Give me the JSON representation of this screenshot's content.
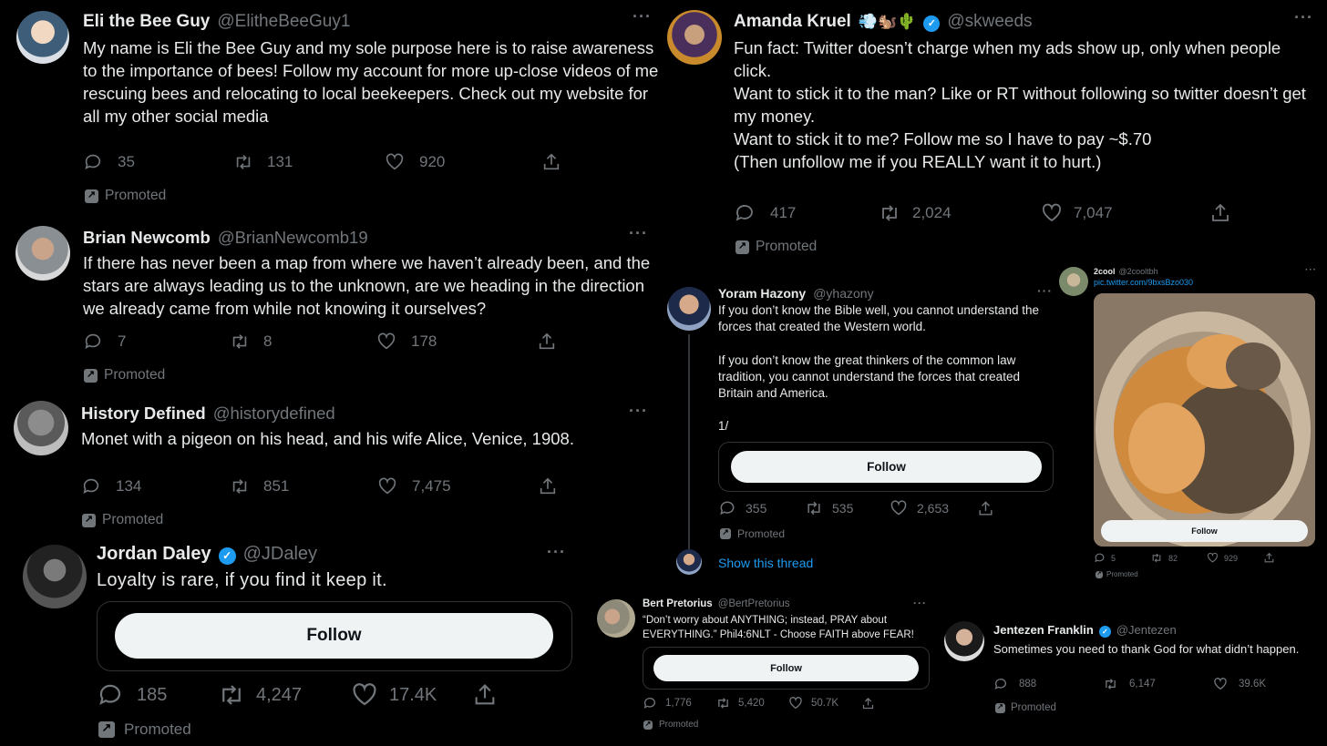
{
  "tweets": {
    "eli": {
      "name": "Eli the Bee Guy",
      "handle": "@ElitheBeeGuy1",
      "text": "My name is Eli the Bee Guy and my sole purpose here is to raise awareness to the importance of bees! Follow my account for more up-close videos of me rescuing bees and relocating to local beekeepers. Check out my website for all my other social media",
      "replies": "35",
      "retweets": "131",
      "likes": "920",
      "promoted": "Promoted"
    },
    "brian": {
      "name": "Brian Newcomb",
      "handle": "@BrianNewcomb19",
      "text": "If there has never been a map from where we haven’t already been, and the stars are always leading us to the unknown, are we heading in the direction we already came from while not knowing it ourselves?",
      "replies": "7",
      "retweets": "8",
      "likes": "178",
      "promoted": "Promoted"
    },
    "history": {
      "name": "History Defined",
      "handle": "@historydefined",
      "text": "Monet with a pigeon on his head, and his wife Alice, Venice, 1908.",
      "replies": "134",
      "retweets": "851",
      "likes": "7,475",
      "promoted": "Promoted"
    },
    "jordan": {
      "name": "Jordan Daley",
      "handle": "@JDaley",
      "text": "Loyalty is rare, if you find it keep it.",
      "follow": "Follow",
      "replies": "185",
      "retweets": "4,247",
      "likes": "17.4K",
      "promoted": "Promoted"
    },
    "amanda": {
      "name": "Amanda Kruel",
      "emojis": "💨🐿️🌵",
      "handle": "@skweeds",
      "text_lines": [
        "Fun fact: Twitter doesn’t charge when my ads show up, only when people click.",
        "Want to stick it to the man? Like or RT without following so twitter doesn’t get my money.",
        "Want to stick it to me? Follow me so I have to pay ~$.70",
        "(Then unfollow me if you REALLY want it to hurt.)"
      ],
      "replies": "417",
      "retweets": "2,024",
      "likes": "7,047",
      "promoted": "Promoted"
    },
    "yoram": {
      "name": "Yoram Hazony",
      "handle": "@yhazony",
      "text_lines": [
        "If you don’t know the Bible well, you cannot understand the forces that created the Western world.",
        "If you don’t know the great thinkers of the common law tradition, you cannot understand the forces that created Britain and America.",
        "1/"
      ],
      "follow": "Follow",
      "replies": "355",
      "retweets": "535",
      "likes": "2,653",
      "promoted": "Promoted",
      "show_thread": "Show this thread"
    },
    "cool": {
      "name": "2cool",
      "handle": "@2cooltbh",
      "link": "pic.twitter.com/9bxsBzo030",
      "follow": "Follow",
      "replies": "5",
      "retweets": "82",
      "likes": "929",
      "promoted": "Promoted"
    },
    "bert": {
      "name": "Bert Pretorius",
      "handle": "@BertPretorius",
      "text": "“Don’t worry about ANYTHING; instead, PRAY about EVERYTHING.” Phil4:6NLT - Choose FAITH above FEAR!",
      "follow": "Follow",
      "replies": "1,776",
      "retweets": "5,420",
      "likes": "50.7K",
      "promoted": "Promoted"
    },
    "jentezen": {
      "name": "Jentezen Franklin",
      "handle": "@Jentezen",
      "text": "Sometimes you need to thank God for what didn’t happen.",
      "replies": "888",
      "retweets": "6,147",
      "likes": "39.6K",
      "promoted": "Promoted"
    }
  },
  "colors": {
    "background": "#000000",
    "text": "#e7e9ea",
    "muted": "#71767b",
    "accent": "#1d9bf0",
    "follow_bg": "#eff3f4"
  },
  "icons": [
    "reply-icon",
    "retweet-icon",
    "like-icon",
    "share-icon",
    "promoted-icon",
    "more-icon",
    "verified-icon"
  ]
}
